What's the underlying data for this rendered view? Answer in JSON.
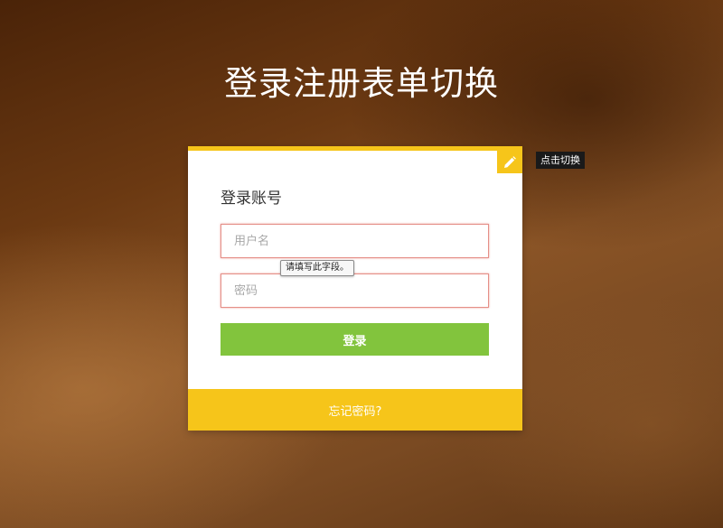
{
  "header": {
    "title": "登录注册表单切换"
  },
  "toggle": {
    "icon": "pencil-icon",
    "tooltip": "点击切换"
  },
  "login_form": {
    "title": "登录账号",
    "username": {
      "value": "",
      "placeholder": "用户名"
    },
    "password": {
      "value": "",
      "placeholder": "密码"
    },
    "validation_message": "请填写此字段。",
    "submit_label": "登录"
  },
  "footer": {
    "forgot_link": "忘记密码?"
  },
  "colors": {
    "accent_yellow": "#f6c51a",
    "button_green": "#82c43d",
    "input_error_border": "#e58f88"
  }
}
